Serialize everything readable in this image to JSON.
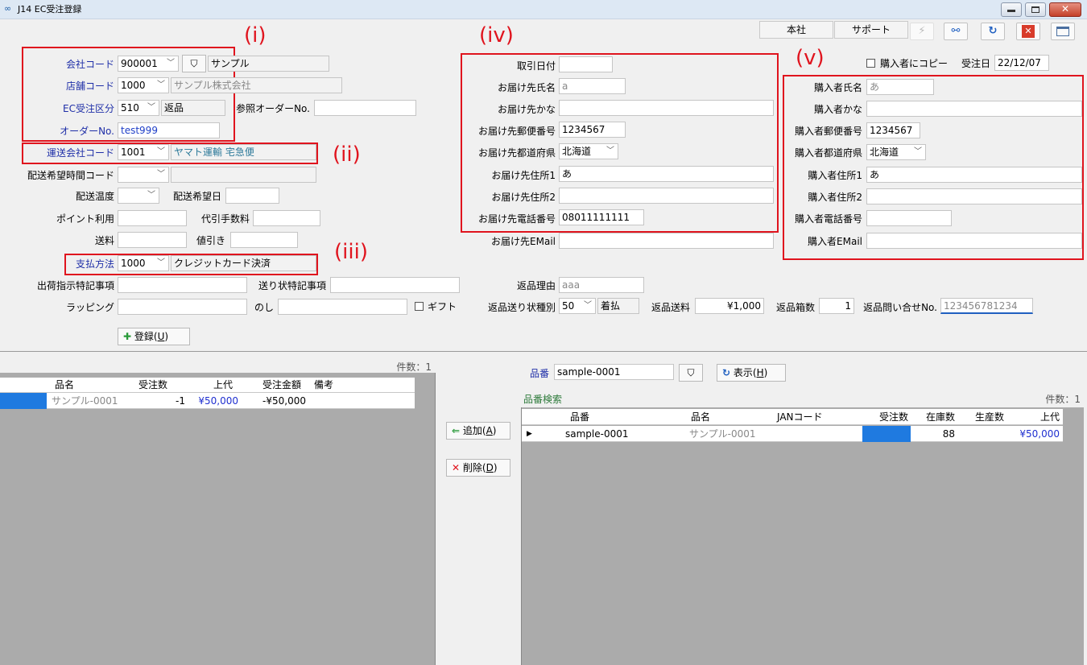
{
  "window": {
    "icon": "infinity-icon",
    "title": "J14 EC受注登録"
  },
  "toolbar": {
    "tab_honsha": "本社",
    "tab_support": "サポート",
    "icons": [
      "lightning-icon",
      "link-icon",
      "refresh-icon",
      "close-icon",
      "window-icon"
    ]
  },
  "annotations": {
    "i": "(i)",
    "ii": "(ii)",
    "iii": "(iii)",
    "iv": "(iv)",
    "v": "(v)"
  },
  "left": {
    "company_label": "会社コード",
    "company_code": "900001",
    "company_name": "サンプル",
    "store_label": "店舗コード",
    "store_code": "1000",
    "store_name": "サンプル株式会社",
    "ec_label": "EC受注区分",
    "ec_code": "510",
    "ec_name": "返品",
    "ref_order_label": "参照オーダーNo.",
    "ref_order": "",
    "order_label": "オーダーNo.",
    "order_no": "test999",
    "carrier_label": "運送会社コード",
    "carrier_code": "1001",
    "carrier_name": "ヤマト運輸 宅急便",
    "time_label": "配送希望時間コード",
    "time_code": "",
    "time_name": "",
    "temp_label": "配送温度",
    "temp_code": "",
    "date_label": "配送希望日",
    "date": "",
    "points_label": "ポイント利用",
    "points": "",
    "cod_label": "代引手数料",
    "cod": "",
    "shipping_label": "送料",
    "shipping": "",
    "discount_label": "値引き",
    "discount": "",
    "payment_label": "支払方法",
    "payment_code": "1000",
    "payment_name": "クレジットカード決済",
    "ship_note_label": "出荷指示特記事項",
    "ship_note": "",
    "slip_note_label": "送り状特記事項",
    "slip_note": "",
    "wrapping_label": "ラッピング",
    "wrapping": "",
    "noshi_label": "のし",
    "noshi": "",
    "gift_label": "ギフト",
    "register_label": "登録(",
    "register_key": "U",
    "register_close": ")"
  },
  "delivery": {
    "date_label": "取引日付",
    "date": "",
    "name_label": "お届け先氏名",
    "name": "a",
    "kana_label": "お届け先かな",
    "kana": "",
    "zip_label": "お届け先郵便番号",
    "zip": "1234567",
    "pref_label": "お届け先都道府県",
    "pref": "北海道",
    "addr1_label": "お届け先住所1",
    "addr1": "あ",
    "addr2_label": "お届け先住所2",
    "addr2": "",
    "phone_label": "お届け先電話番号",
    "phone": "08011111111",
    "email_label": "お届け先EMail",
    "email": "",
    "reason_label": "返品理由",
    "reason": "aaa",
    "slip_type_label": "返品送り状種別",
    "slip_type_code": "50",
    "slip_type_name": "着払",
    "fee_label": "返品送料",
    "fee": "¥1,000",
    "boxes_label": "返品箱数",
    "boxes": "1",
    "inquiry_label": "返品問い合せNo.",
    "inquiry": "123456781234"
  },
  "buyer": {
    "copy_label": "購入者にコピー",
    "order_date_label": "受注日",
    "order_date": "22/12/07",
    "name_label": "購入者氏名",
    "name": "あ",
    "kana_label": "購入者かな",
    "kana": "",
    "zip_label": "購入者郵便番号",
    "zip": "1234567",
    "pref_label": "購入者都道府県",
    "pref": "北海道",
    "addr1_label": "購入者住所1",
    "addr1": "あ",
    "addr2_label": "購入者住所2",
    "addr2": "",
    "phone_label": "購入者電話番号",
    "phone": "",
    "email_label": "購入者EMail",
    "email": ""
  },
  "order_grid": {
    "count": "件数：1",
    "headers": [
      "品名",
      "受注数",
      "上代",
      "受注金額",
      "備考"
    ],
    "rows": [
      {
        "name": "サンプル-0001",
        "qty": "-1",
        "price": "¥50,000",
        "amount": "-¥50,000",
        "note": ""
      }
    ]
  },
  "middle": {
    "add_label": "追加(",
    "add_key": "A",
    "add_close": ")",
    "delete_label": "削除(",
    "delete_key": "D",
    "delete_close": ")"
  },
  "search": {
    "code_label": "品番",
    "code": "sample-0001",
    "show_label": "表示(",
    "show_key": "H",
    "show_close": ")",
    "title": "品番検索",
    "count": "件数：1",
    "headers": [
      "品番",
      "品名",
      "JANコード",
      "受注数",
      "在庫数",
      "生産数",
      "上代"
    ],
    "rows": [
      {
        "code": "sample-0001",
        "name": "サンプル-0001",
        "jan": "",
        "qty": "",
        "stock": "88",
        "prod": "",
        "price": "¥50,000"
      }
    ]
  }
}
